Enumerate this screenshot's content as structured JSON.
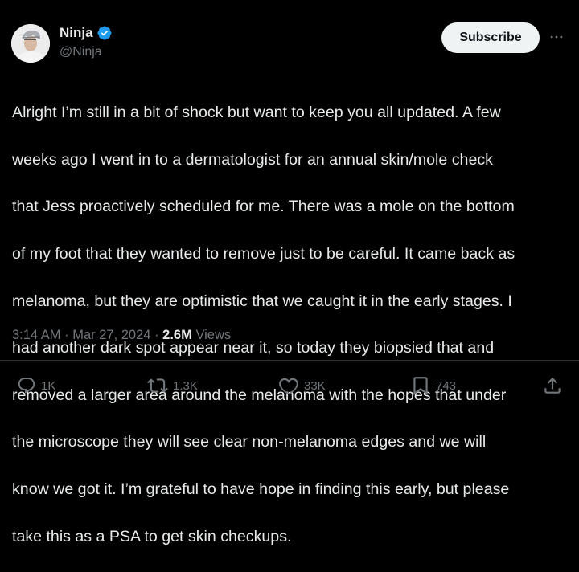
{
  "author": {
    "name": "Ninja",
    "handle": "@Ninja",
    "verified_icon": "verified-badge-icon"
  },
  "header": {
    "subscribe_label": "Subscribe",
    "more_icon": "more-icon"
  },
  "tweet": {
    "lines": [
      "Alright I’m still in a bit of shock but want to keep you all updated. A few",
      "weeks ago I went in to a dermatologist for an annual skin/mole check",
      "that Jess proactively scheduled for me. There was a mole on the bottom",
      "of my foot that they wanted to remove just to be careful. It came back as",
      "melanoma, but they are optimistic that we caught it in the early stages. I",
      "had another dark spot appear near it, so today they biopsied that and",
      "removed a larger area around the melanoma with the hopes that under",
      "the microscope they will see clear non-melanoma edges and we will",
      "know we got it. I’m grateful to have hope in finding this early, but please",
      "take this as a PSA to get skin checkups."
    ]
  },
  "meta": {
    "time": "3:14 AM",
    "separator": "·",
    "date": "Mar 27, 2024",
    "views_count": "2.6M",
    "views_label": "Views"
  },
  "actions": {
    "replies": "1K",
    "reposts": "1.3K",
    "likes": "33K",
    "bookmarks": "743"
  },
  "colors": {
    "background": "#000000",
    "text": "#e7e9ea",
    "secondary": "#71767b",
    "verified": "#1d9bf0"
  }
}
